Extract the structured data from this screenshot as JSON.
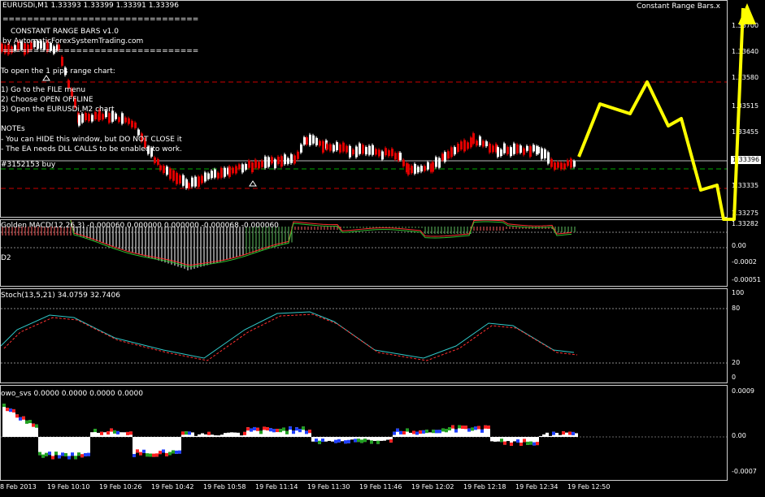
{
  "header": {
    "symbol_line": "EURUSDi,M1  1.33393 1.33399 1.33391 1.33396",
    "ea_name": "Constant Range Bars.x"
  },
  "ea_info": {
    "title_line": "CONSTANT RANGE BARS v1.0",
    "by_line": "by AutomaticForexSystemTrading.com",
    "separator": "================================",
    "instructions_title": "To open the 1 pips range chart:",
    "steps": [
      "1) Go to the FILE menu",
      "2) Choose OPEN OFFLINE",
      "3) Open the EURUSDi,M2 chart"
    ],
    "notes_title": "NOTEs",
    "notes": [
      "- You can HIDE this window, but DO NOT CLOSE it",
      "- The EA needs DLL CALLS to be enabled to work."
    ],
    "order_label": "#3152153 buy"
  },
  "price_axis": {
    "labels": [
      "1.33700",
      "1.33640",
      "1.33580",
      "1.33515",
      "1.33455",
      "1.33396",
      "1.33335",
      "1.33275"
    ],
    "current": "1.33396",
    "sub": "1.33282"
  },
  "macd": {
    "title": "Golden MACD(12,26,3) -0.000060 0.000000 0.000000 -0.000068 -0.000060",
    "d2_label": "D2",
    "axis": [
      "0.00",
      "-0.0002",
      "-0.00051"
    ]
  },
  "stoch": {
    "title": "Stoch(13,5,21) 34.0759 32.7406",
    "axis": [
      "100",
      "80",
      "20",
      "0"
    ]
  },
  "owo": {
    "title": "owo_svs 0.0000 0.0000 0.0000 0.0000",
    "axis": [
      "0.0009",
      "0.00",
      "-0.0007"
    ]
  },
  "time_axis": [
    "8 Feb 2013",
    "19 Feb 10:10",
    "19 Feb 10:26",
    "19 Feb 10:42",
    "19 Feb 10:58",
    "19 Feb 11:14",
    "19 Feb 11:30",
    "19 Feb 11:46",
    "19 Feb 12:02",
    "19 Feb 12:18",
    "19 Feb 12:34",
    "19 Feb 12:50"
  ],
  "colors": {
    "bull": "#ffffff",
    "bear": "#e00000",
    "annotation": "#ffff00",
    "grid": "#cc0000",
    "order": "#00aa00"
  }
}
